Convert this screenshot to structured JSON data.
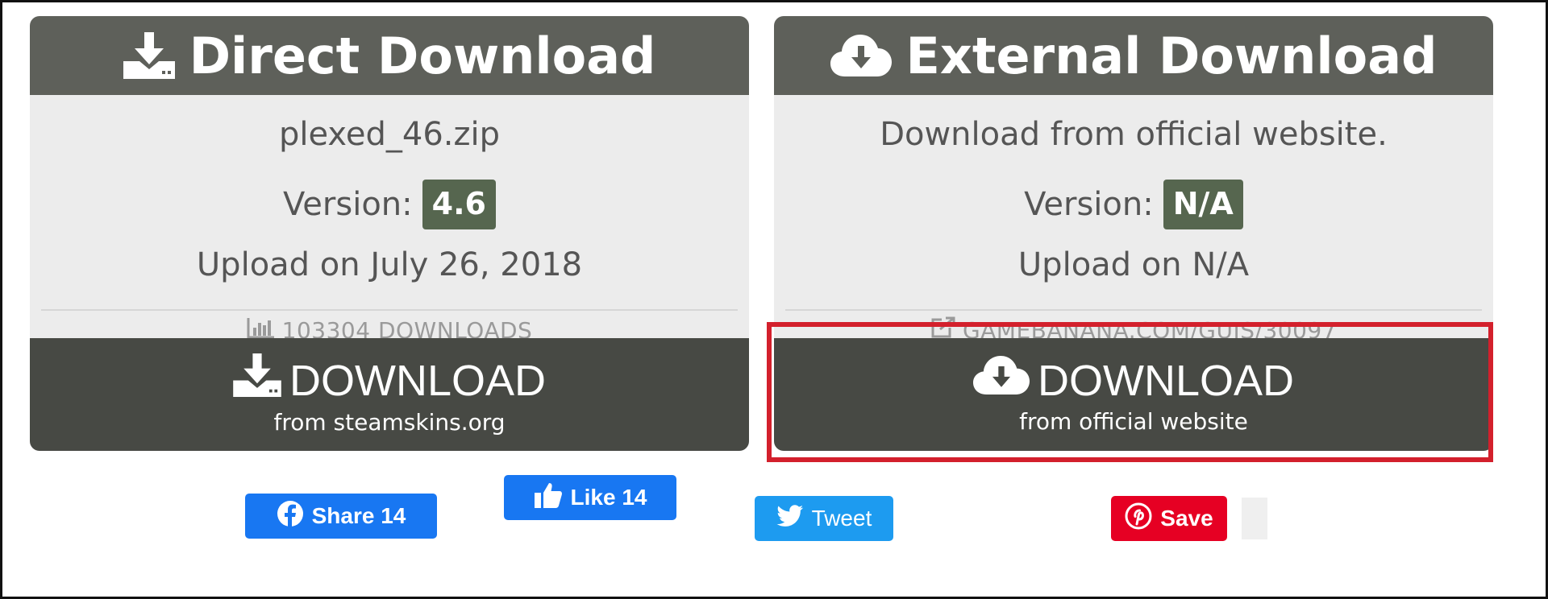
{
  "direct": {
    "title": "Direct Download",
    "filename": "plexed_46.zip",
    "version_label": "Version:",
    "version_value": "4.6",
    "upload": "Upload on July 26, 2018",
    "stat": "103304 DOWNLOADS",
    "button_label": "DOWNLOAD",
    "button_sub": "from steamskins.org"
  },
  "external": {
    "title": "External Download",
    "description": "Download from official website.",
    "version_label": "Version:",
    "version_value": "N/A",
    "upload": "Upload on N/A",
    "stat": "GAMEBANANA.COM/GUIS/30097",
    "button_label": "DOWNLOAD",
    "button_sub": "from official website"
  },
  "social": {
    "share": "Share 14",
    "like": "Like 14",
    "tweet": "Tweet",
    "save": "Save"
  },
  "colors": {
    "header": "#5e605a",
    "button": "#474944",
    "badge": "#56664f",
    "highlight": "#d3202c",
    "facebook": "#1877f2",
    "twitter": "#1d9bf0",
    "pinterest": "#e60023"
  }
}
